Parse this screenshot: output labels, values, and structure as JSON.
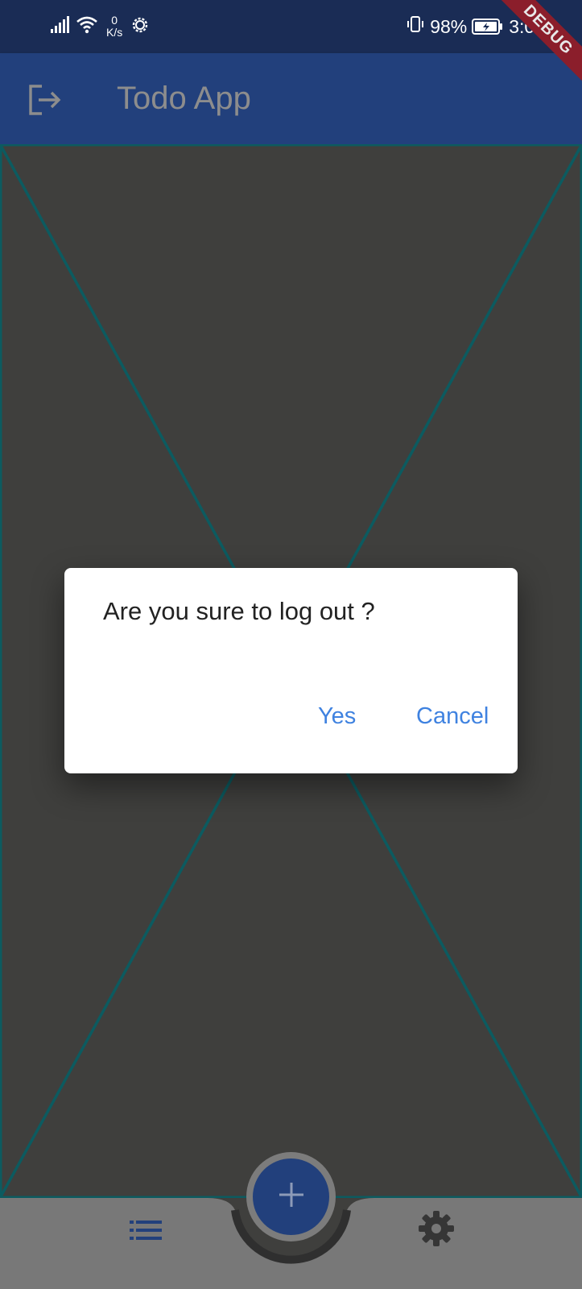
{
  "status_bar": {
    "net_speed_value": "0",
    "net_speed_unit": "K/s",
    "battery_percent": "98%",
    "time": "3:02"
  },
  "app_bar": {
    "title": "Todo App",
    "leading_icon": "logout-icon"
  },
  "debug_banner": "DEBUG",
  "dialog": {
    "message": "Are you sure to log out ?",
    "yes_label": "Yes",
    "cancel_label": "Cancel"
  },
  "bottom_nav": {
    "left_icon": "list-icon",
    "right_icon": "settings-icon",
    "fab_icon": "plus-icon"
  },
  "colors": {
    "status_bar": "#1a2c55",
    "app_bar": "#22407c",
    "body_background": "#3f3f3d",
    "placeholder_lines": "#0c5b60",
    "bottom_bar": "#787878",
    "dialog_button": "#3f82e0",
    "debug_banner": "#8b1e2b"
  }
}
